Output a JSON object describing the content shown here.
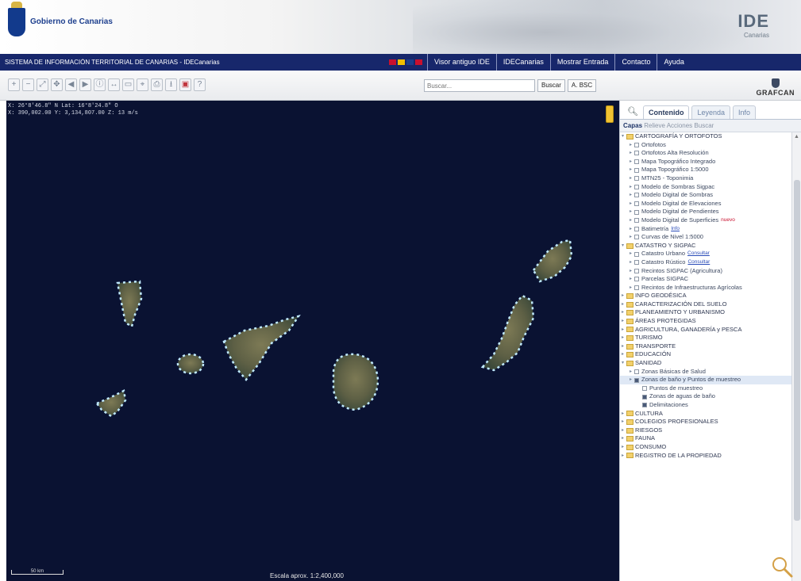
{
  "header": {
    "gov_name": "Gobierno de Canarias",
    "gov_sub": "",
    "ide_title": "IDE",
    "ide_sub": "Canarias"
  },
  "navbar": {
    "title": "SISTEMA DE INFORMACIÓN TERRITORIAL DE CANARIAS - IDECanarias",
    "flags": [
      "#c8102e",
      "#f1bf00",
      "#1a3e8c",
      "#c8102e"
    ],
    "links": [
      "Visor antiguo IDE",
      "IDECanarias",
      "Mostrar Entrada",
      "Contacto",
      "Ayuda"
    ]
  },
  "toolbar": {
    "tools": [
      "zoom-in",
      "zoom-out",
      "zoom-extent",
      "pan",
      "previous",
      "next",
      "identify",
      "measure-distance",
      "measure-area",
      "coordinates",
      "print",
      "download",
      "pdf",
      "help"
    ],
    "search_placeholder": "Buscar...",
    "search_button": "Buscar",
    "clear_button": "A. BSC",
    "brand": "GRAFCAN"
  },
  "map": {
    "coords_line1": "X: 26°8'46.8\" N  Lat: 16°8'24.8\" O",
    "coords_line2": "X: 390,002.00  Y: 3,134,807.00  Z: 13 m/s",
    "scale_label": "Escala aprox. 1:2,400,000",
    "scalebar_label": "50 km"
  },
  "panel": {
    "tabs": [
      "Contenido",
      "Leyenda",
      "Info"
    ],
    "active_tab": "Contenido",
    "subtabs": [
      "Capas",
      "Relieve",
      "Acciones",
      "Buscar"
    ],
    "tree": [
      {
        "type": "group",
        "label": "CARTOGRAFÍA Y ORTOFOTOS",
        "expanded": true
      },
      {
        "type": "layer",
        "label": "Ortofotos"
      },
      {
        "type": "layer",
        "label": "Ortofotos Alta Resolución"
      },
      {
        "type": "layer",
        "label": "Mapa Topográfico Integrado"
      },
      {
        "type": "layer",
        "label": "Mapa Topográfico 1:5000"
      },
      {
        "type": "layer",
        "label": "MTN25 - Toponimia"
      },
      {
        "type": "layer",
        "label": "Modelo de Sombras Sigpac"
      },
      {
        "type": "layer",
        "label": "Modelo Digital de Sombras"
      },
      {
        "type": "layer",
        "label": "Modelo Digital de Elevaciones"
      },
      {
        "type": "layer",
        "label": "Modelo Digital de Pendientes"
      },
      {
        "type": "layer",
        "label": "Modelo Digital de Superficies",
        "badge": "nuevo",
        "badge_red": true
      },
      {
        "type": "layer",
        "label": "Batimetría",
        "badge": "Info"
      },
      {
        "type": "layer",
        "label": "Curvas de Nivel 1:5000"
      },
      {
        "type": "group",
        "label": "CATASTRO Y SIGPAC",
        "expanded": true
      },
      {
        "type": "layer",
        "label": "Catastro Urbano",
        "badge": "Consultar"
      },
      {
        "type": "layer",
        "label": "Catastro Rústico",
        "badge": "Consultar"
      },
      {
        "type": "layer",
        "label": "Recintos SIGPAC (Agricultura)"
      },
      {
        "type": "layer",
        "label": "Parcelas SIGPAC"
      },
      {
        "type": "layer",
        "label": "Recintos de Infraestructuras Agrícolas"
      },
      {
        "type": "group",
        "label": "INFO GEODÉSICA"
      },
      {
        "type": "group",
        "label": "CARACTERIZACIÓN DEL SUELO"
      },
      {
        "type": "group",
        "label": "PLANEAMIENTO Y URBANISMO"
      },
      {
        "type": "group",
        "label": "ÁREAS PROTEGIDAS"
      },
      {
        "type": "group",
        "label": "AGRICULTURA, GANADERÍA y PESCA"
      },
      {
        "type": "group",
        "label": "TURISMO"
      },
      {
        "type": "group",
        "label": "TRANSPORTE"
      },
      {
        "type": "group",
        "label": "EDUCACIÓN"
      },
      {
        "type": "group",
        "label": "SANIDAD",
        "expanded": true
      },
      {
        "type": "layer",
        "label": "Zonas Básicas de Salud"
      },
      {
        "type": "layer",
        "label": "Zonas de baño y Puntos de muestreo",
        "checked": true,
        "highlight": true
      },
      {
        "type": "sublayer",
        "label": "Puntos de muestreo"
      },
      {
        "type": "sublayer",
        "label": "Zonas de aguas de baño",
        "checked": true
      },
      {
        "type": "sublayer",
        "label": "Delimitaciones",
        "checked": true
      },
      {
        "type": "group",
        "label": "CULTURA"
      },
      {
        "type": "group",
        "label": "COLEGIOS PROFESIONALES"
      },
      {
        "type": "group",
        "label": "RIESGOS"
      },
      {
        "type": "group",
        "label": "FAUNA"
      },
      {
        "type": "group",
        "label": "CONSUMO"
      },
      {
        "type": "group",
        "label": "REGISTRO DE LA PROPIEDAD"
      }
    ]
  }
}
